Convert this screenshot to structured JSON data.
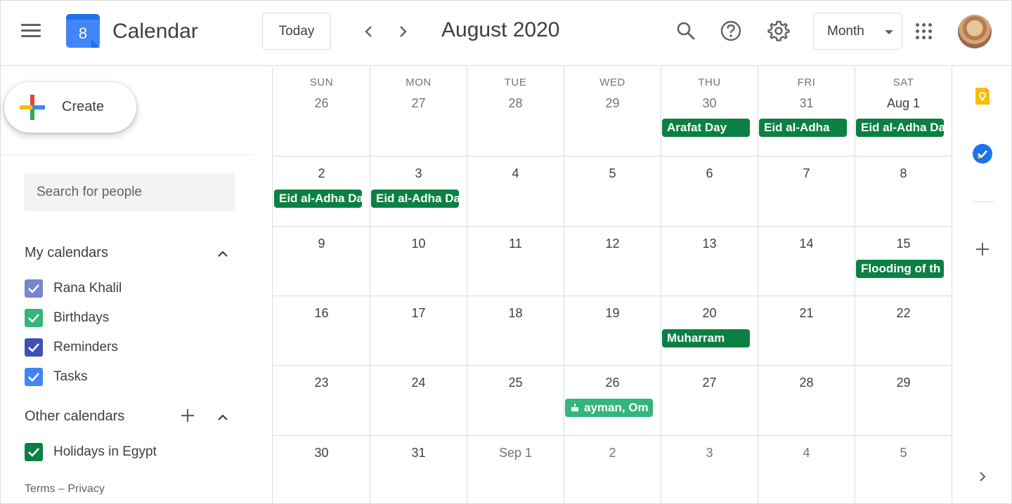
{
  "header": {
    "app_title": "Calendar",
    "logo_day": "8",
    "today_label": "Today",
    "month_label": "August 2020",
    "view_label": "Month",
    "icons": [
      "menu-icon",
      "chevron-left-icon",
      "chevron-right-icon",
      "search-icon",
      "help-icon",
      "settings-icon",
      "apps-icon"
    ]
  },
  "sidebar": {
    "create_label": "Create",
    "people_search_placeholder": "Search for people",
    "my_calendars_title": "My calendars",
    "my_calendars": [
      {
        "label": "Rana Khalil",
        "color": "#7986cb"
      },
      {
        "label": "Birthdays",
        "color": "#33b679"
      },
      {
        "label": "Reminders",
        "color": "#3f51b5"
      },
      {
        "label": "Tasks",
        "color": "#4285f4"
      }
    ],
    "other_calendars_title": "Other calendars",
    "other_calendars": [
      {
        "label": "Holidays in Egypt",
        "color": "#0b8043"
      }
    ],
    "footer": {
      "terms": "Terms",
      "separator": "–",
      "privacy": "Privacy"
    }
  },
  "calendar": {
    "weekdays": [
      "SUN",
      "MON",
      "TUE",
      "WED",
      "THU",
      "FRI",
      "SAT"
    ],
    "weeks": [
      [
        {
          "day": "26",
          "muted": true,
          "events": []
        },
        {
          "day": "27",
          "muted": true,
          "events": []
        },
        {
          "day": "28",
          "muted": true,
          "events": []
        },
        {
          "day": "29",
          "muted": true,
          "events": []
        },
        {
          "day": "30",
          "muted": true,
          "events": [
            {
              "title": "Arafat Day",
              "type": "holiday"
            }
          ]
        },
        {
          "day": "31",
          "muted": true,
          "events": [
            {
              "title": "Eid al-Adha",
              "type": "holiday"
            }
          ]
        },
        {
          "day": "Aug 1",
          "muted": false,
          "events": [
            {
              "title": "Eid al-Adha Da",
              "type": "holiday"
            }
          ]
        }
      ],
      [
        {
          "day": "2",
          "muted": false,
          "events": [
            {
              "title": "Eid al-Adha Da",
              "type": "holiday"
            }
          ]
        },
        {
          "day": "3",
          "muted": false,
          "events": [
            {
              "title": "Eid al-Adha Da",
              "type": "holiday"
            }
          ]
        },
        {
          "day": "4",
          "muted": false,
          "events": []
        },
        {
          "day": "5",
          "muted": false,
          "events": []
        },
        {
          "day": "6",
          "muted": false,
          "events": []
        },
        {
          "day": "7",
          "muted": false,
          "events": []
        },
        {
          "day": "8",
          "muted": false,
          "events": []
        }
      ],
      [
        {
          "day": "9",
          "muted": false,
          "events": []
        },
        {
          "day": "10",
          "muted": false,
          "events": []
        },
        {
          "day": "11",
          "muted": false,
          "events": []
        },
        {
          "day": "12",
          "muted": false,
          "events": []
        },
        {
          "day": "13",
          "muted": false,
          "events": []
        },
        {
          "day": "14",
          "muted": false,
          "events": []
        },
        {
          "day": "15",
          "muted": false,
          "events": [
            {
              "title": "Flooding of th",
              "type": "holiday"
            }
          ]
        }
      ],
      [
        {
          "day": "16",
          "muted": false,
          "events": []
        },
        {
          "day": "17",
          "muted": false,
          "events": []
        },
        {
          "day": "18",
          "muted": false,
          "events": []
        },
        {
          "day": "19",
          "muted": false,
          "events": []
        },
        {
          "day": "20",
          "muted": false,
          "events": [
            {
              "title": "Muharram",
              "type": "holiday"
            }
          ]
        },
        {
          "day": "21",
          "muted": false,
          "events": []
        },
        {
          "day": "22",
          "muted": false,
          "events": []
        }
      ],
      [
        {
          "day": "23",
          "muted": false,
          "events": []
        },
        {
          "day": "24",
          "muted": false,
          "events": []
        },
        {
          "day": "25",
          "muted": false,
          "events": []
        },
        {
          "day": "26",
          "muted": false,
          "events": [
            {
              "title": "ayman, Om",
              "type": "birthday"
            }
          ]
        },
        {
          "day": "27",
          "muted": false,
          "events": []
        },
        {
          "day": "28",
          "muted": false,
          "events": []
        },
        {
          "day": "29",
          "muted": false,
          "events": []
        }
      ],
      [
        {
          "day": "30",
          "muted": false,
          "events": []
        },
        {
          "day": "31",
          "muted": false,
          "events": []
        },
        {
          "day": "Sep 1",
          "muted": true,
          "events": []
        },
        {
          "day": "2",
          "muted": true,
          "events": []
        },
        {
          "day": "3",
          "muted": true,
          "events": []
        },
        {
          "day": "4",
          "muted": true,
          "events": []
        },
        {
          "day": "5",
          "muted": true,
          "events": []
        }
      ]
    ]
  },
  "colors": {
    "holiday": "#0b8043",
    "birthday": "#33b679",
    "brand_blue": "#4285f4"
  },
  "right_rail": {
    "icons": [
      "keep-icon",
      "tasks-icon",
      "add-addon-icon",
      "chevron-right-icon"
    ]
  }
}
